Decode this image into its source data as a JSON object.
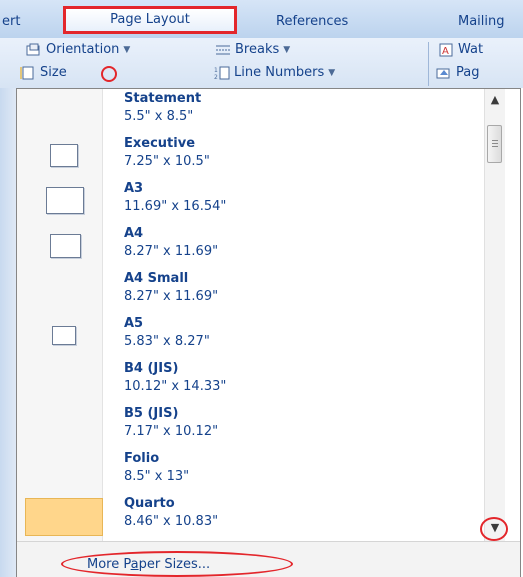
{
  "tabs": {
    "partial_left": "ert",
    "active": "Page Layout",
    "references": "References",
    "mailings_partial": "Mailing"
  },
  "ribbon": {
    "orientation": "Orientation",
    "breaks": "Breaks",
    "size": "Size",
    "line_numbers": "Line Numbers",
    "watermark_partial": "Wat",
    "page_partial": "Pag"
  },
  "paper_sizes": [
    {
      "name": "Statement",
      "dims": "5.5\" x 8.5\""
    },
    {
      "name": "Executive",
      "dims": "7.25\" x 10.5\""
    },
    {
      "name": "A3",
      "dims": "11.69\" x 16.54\""
    },
    {
      "name": "A4",
      "dims": "8.27\" x 11.69\""
    },
    {
      "name": "A4 Small",
      "dims": "8.27\" x 11.69\""
    },
    {
      "name": "A5",
      "dims": "5.83\" x 8.27\""
    },
    {
      "name": "B4 (JIS)",
      "dims": "10.12\" x 14.33\""
    },
    {
      "name": "B5 (JIS)",
      "dims": "7.17\" x 10.12\""
    },
    {
      "name": "Folio",
      "dims": "8.5\" x 13\""
    },
    {
      "name": "Quarto",
      "dims": "8.46\" x 10.83\""
    }
  ],
  "footer": {
    "more_pre": "More P",
    "more_mid": "a",
    "more_post": "per Sizes..."
  },
  "colors": {
    "accent_text": "#15428b",
    "highlight": "#e3262b",
    "selected_bg": "#ffd68b"
  }
}
